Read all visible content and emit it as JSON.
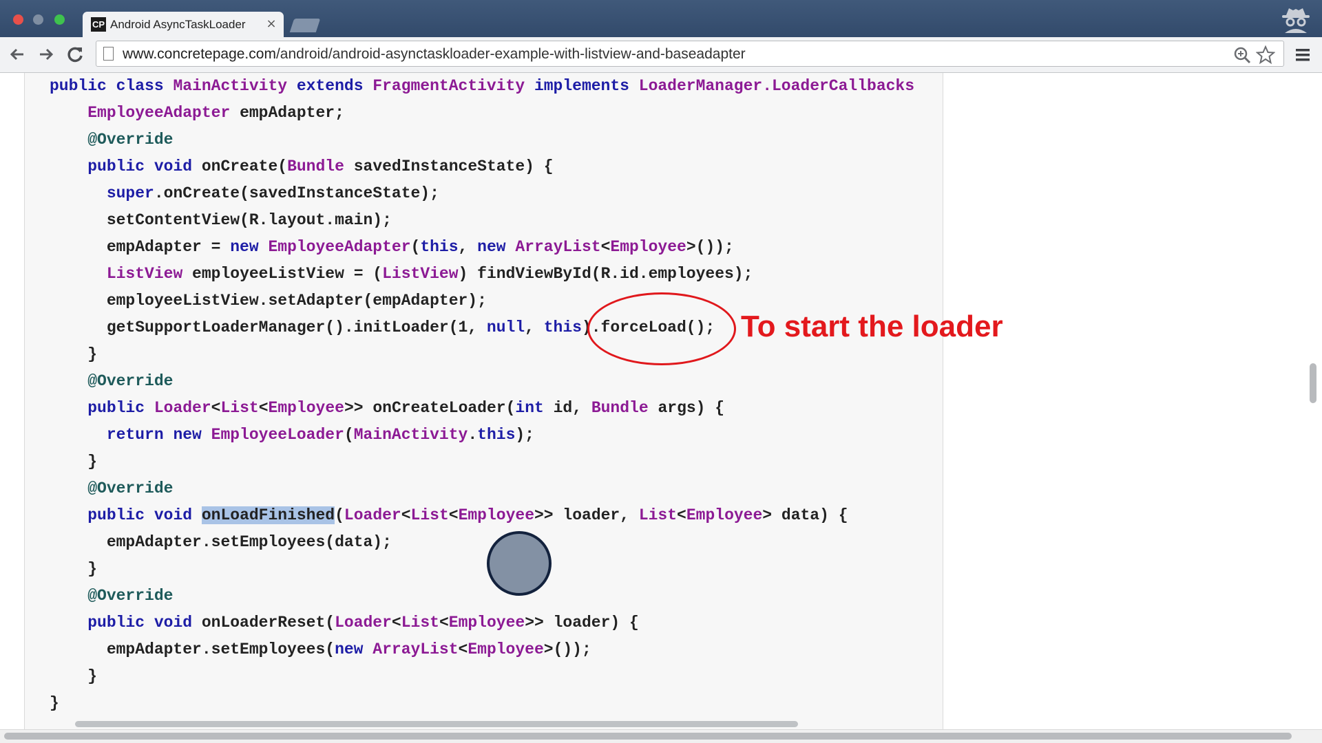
{
  "browser": {
    "tab_title": "Android AsyncTaskLoader",
    "tab_favicon": "CP",
    "tab_close": "×",
    "url_host": "www.concretepage.com",
    "url_path": "/android/android-asynctaskloader-example-with-listview-and-baseadapter"
  },
  "icons": {
    "back": "arrow-left-icon",
    "forward": "arrow-right-icon",
    "reload": "reload-icon",
    "page": "page-icon",
    "zoom": "zoom-icon",
    "bookmark": "star-icon",
    "menu": "hamburger-menu-icon",
    "profile": "incognito-icon"
  },
  "colors": {
    "keyword": "#1d1da6",
    "type": "#8c1a94",
    "annotation": "#1e5a5a",
    "callout": "#e3191d"
  },
  "code_lines": [
    [
      [
        "kw",
        "public class "
      ],
      [
        "type",
        "MainActivity "
      ],
      [
        "kw",
        "extends "
      ],
      [
        "type",
        "FragmentActivity "
      ],
      [
        "kw",
        "implements "
      ],
      [
        "type",
        "LoaderManager.LoaderCallbacks"
      ]
    ],
    [
      [
        "plain",
        "    "
      ],
      [
        "type",
        "EmployeeAdapter"
      ],
      [
        "plain",
        " empAdapter;"
      ]
    ],
    [
      [
        "plain",
        "    "
      ],
      [
        "ann",
        "@Override"
      ]
    ],
    [
      [
        "plain",
        "    "
      ],
      [
        "kw",
        "public void"
      ],
      [
        "plain",
        " onCreate("
      ],
      [
        "type",
        "Bundle"
      ],
      [
        "plain",
        " savedInstanceState) {"
      ]
    ],
    [
      [
        "plain",
        "      "
      ],
      [
        "kw",
        "super"
      ],
      [
        "plain",
        ".onCreate(savedInstanceState);"
      ]
    ],
    [
      [
        "plain",
        "      setContentView(R.layout.main);"
      ]
    ],
    [
      [
        "plain",
        "      empAdapter = "
      ],
      [
        "kw",
        "new "
      ],
      [
        "type",
        "EmployeeAdapter"
      ],
      [
        "plain",
        "("
      ],
      [
        "kw",
        "this"
      ],
      [
        "plain",
        ", "
      ],
      [
        "kw",
        "new "
      ],
      [
        "type",
        "ArrayList"
      ],
      [
        "plain",
        "<"
      ],
      [
        "type",
        "Employee"
      ],
      [
        "plain",
        ">());"
      ]
    ],
    [
      [
        "plain",
        "      "
      ],
      [
        "type",
        "ListView"
      ],
      [
        "plain",
        " employeeListView = ("
      ],
      [
        "type",
        "ListView"
      ],
      [
        "plain",
        ") findViewById(R.id.employees);"
      ]
    ],
    [
      [
        "plain",
        "      employeeListView.setAdapter(empAdapter);"
      ]
    ],
    [
      [
        "plain",
        "      getSupportLoaderManager().initLoader(1, "
      ],
      [
        "kw",
        "null"
      ],
      [
        "plain",
        ", "
      ],
      [
        "kw",
        "this"
      ],
      [
        "plain",
        ").forceLoad();"
      ]
    ],
    [
      [
        "plain",
        "    }"
      ]
    ],
    [
      [
        "plain",
        "    "
      ],
      [
        "ann",
        "@Override"
      ]
    ],
    [
      [
        "plain",
        "    "
      ],
      [
        "kw",
        "public "
      ],
      [
        "type",
        "Loader"
      ],
      [
        "plain",
        "<"
      ],
      [
        "type",
        "List"
      ],
      [
        "plain",
        "<"
      ],
      [
        "type",
        "Employee"
      ],
      [
        "plain",
        ">> onCreateLoader("
      ],
      [
        "kw",
        "int"
      ],
      [
        "plain",
        " id, "
      ],
      [
        "type",
        "Bundle"
      ],
      [
        "plain",
        " args) {"
      ]
    ],
    [
      [
        "plain",
        "      "
      ],
      [
        "kw",
        "return new "
      ],
      [
        "type",
        "EmployeeLoader"
      ],
      [
        "plain",
        "("
      ],
      [
        "type",
        "MainActivity"
      ],
      [
        "plain",
        "."
      ],
      [
        "kw",
        "this"
      ],
      [
        "plain",
        ");"
      ]
    ],
    [
      [
        "plain",
        "    }"
      ]
    ],
    [
      [
        "plain",
        "    "
      ],
      [
        "ann",
        "@Override"
      ]
    ],
    [
      [
        "plain",
        "    "
      ],
      [
        "kw",
        "public void"
      ],
      [
        "plain",
        " "
      ],
      [
        "highlight",
        "onLoadFinished"
      ],
      [
        "plain",
        "("
      ],
      [
        "type",
        "Loader"
      ],
      [
        "plain",
        "<"
      ],
      [
        "type",
        "List"
      ],
      [
        "plain",
        "<"
      ],
      [
        "type",
        "Employee"
      ],
      [
        "plain",
        ">> loader, "
      ],
      [
        "type",
        "List"
      ],
      [
        "plain",
        "<"
      ],
      [
        "type",
        "Employee"
      ],
      [
        "plain",
        "> data) {"
      ]
    ],
    [
      [
        "plain",
        "      empAdapter.setEmployees(data);"
      ]
    ],
    [
      [
        "plain",
        "    }"
      ]
    ],
    [
      [
        "plain",
        "    "
      ],
      [
        "ann",
        "@Override"
      ]
    ],
    [
      [
        "plain",
        "    "
      ],
      [
        "kw",
        "public void"
      ],
      [
        "plain",
        " onLoaderReset("
      ],
      [
        "type",
        "Loader"
      ],
      [
        "plain",
        "<"
      ],
      [
        "type",
        "List"
      ],
      [
        "plain",
        "<"
      ],
      [
        "type",
        "Employee"
      ],
      [
        "plain",
        ">> loader) {"
      ]
    ],
    [
      [
        "plain",
        "      empAdapter.setEmployees("
      ],
      [
        "kw",
        "new "
      ],
      [
        "type",
        "ArrayList"
      ],
      [
        "plain",
        "<"
      ],
      [
        "type",
        "Employee"
      ],
      [
        "plain",
        ">());"
      ]
    ],
    [
      [
        "plain",
        "    }"
      ]
    ],
    [
      [
        "plain",
        "}"
      ]
    ]
  ],
  "annotation": {
    "text": "To start the loader"
  }
}
